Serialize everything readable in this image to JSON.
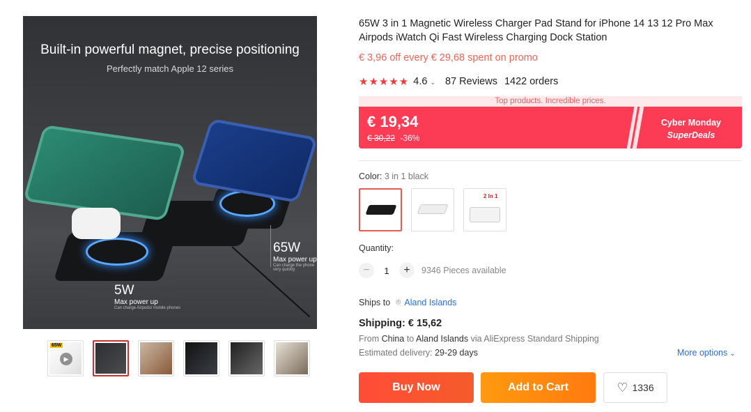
{
  "main_image": {
    "headline": "Built-in powerful magnet, precise positioning",
    "subline": "Perfectly match Apple 12 series",
    "label_65w": "65W",
    "label_65w_sub": "Max power up",
    "label_65w_note": "Can charge the phone very quickly",
    "label_5w": "5W",
    "label_5w_sub": "Max power up",
    "label_5w_note": "Can charge Airpods/ mobile phones"
  },
  "thumbnails": [
    {
      "name": "thumb-1",
      "tag": "65W",
      "video": true
    },
    {
      "name": "thumb-2",
      "active": true
    },
    {
      "name": "thumb-3"
    },
    {
      "name": "thumb-4"
    },
    {
      "name": "thumb-5"
    },
    {
      "name": "thumb-6"
    }
  ],
  "product": {
    "title": "65W 3 in 1 Magnetic Wireless Charger Pad Stand for iPhone 14 13 12 Pro Max Airpods iWatch Qi Fast Wireless Charging Dock Station",
    "promo": "€ 3,96 off every € 29,68 spent on promo",
    "rating": "4.6",
    "stars": "★★★★★",
    "reviews": "87 Reviews",
    "orders": "1422 orders"
  },
  "price": {
    "banner": "Top products. Incredible prices.",
    "current": "€ 19,34",
    "original": "€ 30,22",
    "discount": "-36%",
    "event_line1": "Cyber Monday",
    "event_line2": "SuperDeals",
    "accent_color": "#fc3b55"
  },
  "color": {
    "label": "Color:",
    "selected": "3 in 1 black",
    "options": [
      "3 in 1 black",
      "3 in 1 white",
      "2 in 1"
    ],
    "option3_tag": "2 In 1"
  },
  "quantity": {
    "label": "Quantity:",
    "value": "1",
    "minus": "−",
    "plus": "+",
    "available": "9346 Pieces available"
  },
  "shipping": {
    "ships_to_label": "Ships to",
    "ships_to_value": "Aland Islands",
    "cost": "Shipping: € 15,62",
    "from_prefix": "From",
    "from_origin": "China",
    "from_to": "to",
    "from_dest": "Aland Islands",
    "from_via": "via AliExpress Standard Shipping",
    "est_label": "Estimated delivery:",
    "est_value": "29-29 days",
    "more_options": "More options"
  },
  "actions": {
    "buy_now": "Buy Now",
    "add_to_cart": "Add to Cart",
    "wishlist_count": "1336"
  }
}
